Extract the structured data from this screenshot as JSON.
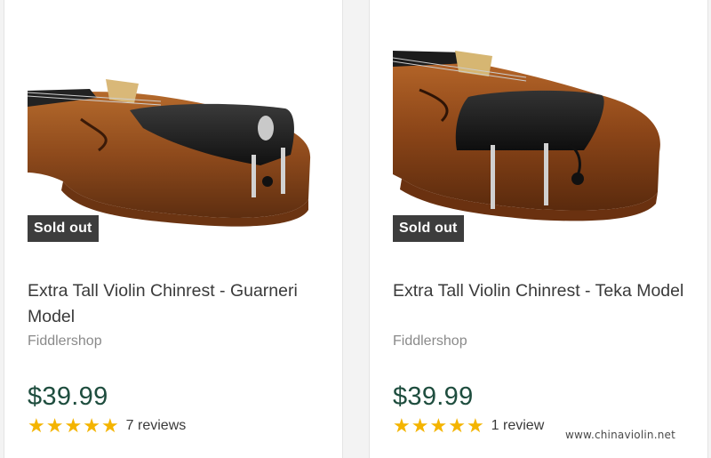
{
  "colors": {
    "price": "#1e4d3e",
    "star": "#f4b400",
    "badge_bg": "#3d3d3d",
    "page_bg": "#f3f3f3"
  },
  "products": [
    {
      "badge": "Sold out",
      "title": "Extra Tall Violin Chinrest - Guarneri Model",
      "vendor": "Fiddlershop",
      "price": "$39.99",
      "rating": 5,
      "reviews": "7 reviews",
      "image_icon": "violin-chinrest-guarneri-image"
    },
    {
      "badge": "Sold out",
      "title": "Extra Tall Violin Chinrest - Teka Model",
      "vendor": "Fiddlershop",
      "price": "$39.99",
      "rating": 5,
      "reviews": "1 review",
      "image_icon": "violin-chinrest-teka-image"
    }
  ],
  "watermark": "www.chinaviolin.net"
}
